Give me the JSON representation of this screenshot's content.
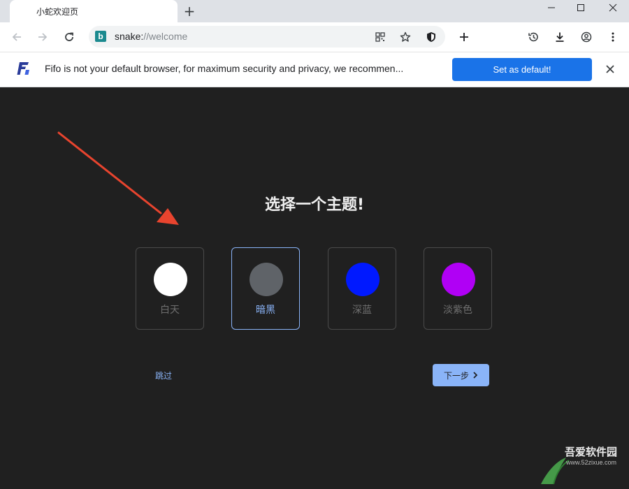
{
  "tab": {
    "title": "小蛇欢迎页"
  },
  "toolbar": {
    "url_scheme": "snake:",
    "url_rest": "//welcome",
    "favicon_letter": "b"
  },
  "infobar": {
    "message": "Fifo is not your default browser, for maximum security and privacy, we recommen...",
    "button_label": "Set as default!"
  },
  "main": {
    "heading": "选择一个主题!",
    "themes": [
      {
        "label": "白天",
        "color": "#ffffff",
        "selected": false
      },
      {
        "label": "暗黑",
        "color": "#5f6368",
        "selected": true
      },
      {
        "label": "深蓝",
        "color": "#0019ff",
        "selected": false
      },
      {
        "label": "淡紫色",
        "color": "#b000f5",
        "selected": false
      }
    ],
    "skip_label": "跳过",
    "next_label": "下一步"
  },
  "colors": {
    "background": "#202020",
    "accent": "#8ab4f8",
    "infobar_button": "#1a73e8",
    "annotation_arrow": "#e8442e"
  },
  "watermark": {
    "title": "吾爱软件园",
    "url": "www.52zixue.com"
  }
}
